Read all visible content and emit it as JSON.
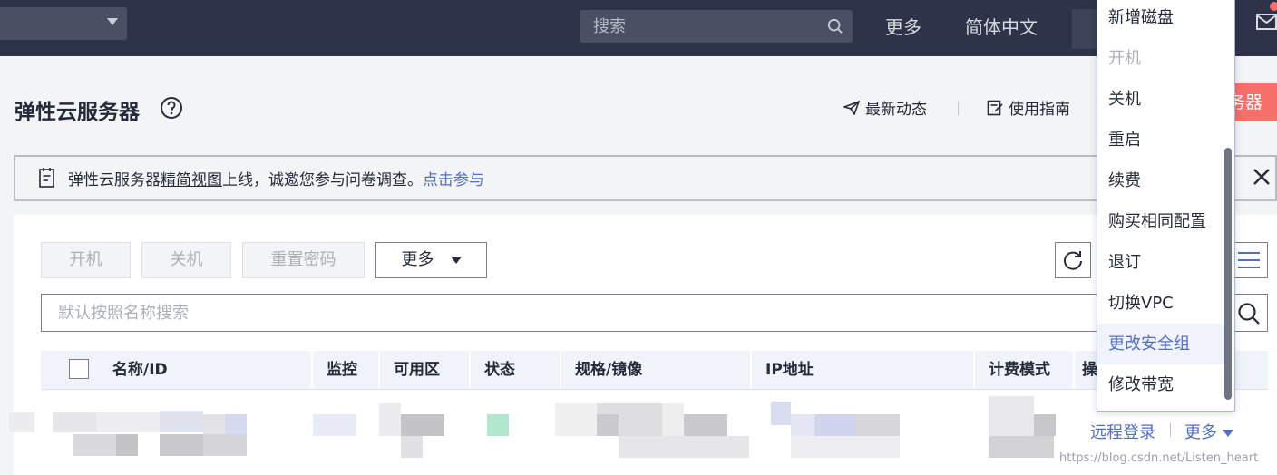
{
  "topbar": {
    "search_placeholder": "搜索",
    "more_label": "更多",
    "language_label": "简体中文"
  },
  "header": {
    "title": "弹性云服务器",
    "latest_news": "最新动态",
    "user_guide": "使用指南",
    "buy_button_partial": "务器"
  },
  "notice": {
    "text_prefix": "弹性云服务器",
    "text_underlined": "精简视图",
    "text_suffix": "上线，诚邀您参与问卷调查。",
    "link": "点击参与"
  },
  "toolbar": {
    "start_label": "开机",
    "stop_label": "关机",
    "reset_password_label": "重置密码",
    "more_label": "更多"
  },
  "search": {
    "placeholder": "默认按照名称搜索"
  },
  "table": {
    "columns": [
      "名称/ID",
      "监控",
      "可用区",
      "状态",
      "规格/镜像",
      "IP地址",
      "计费模式",
      "操"
    ],
    "row": {
      "remote_login": "远程登录",
      "more_label": "更多"
    }
  },
  "dropdown": {
    "items": [
      {
        "label": "新增磁盘",
        "state": "enabled"
      },
      {
        "label": "开机",
        "state": "disabled"
      },
      {
        "label": "关机",
        "state": "enabled"
      },
      {
        "label": "重启",
        "state": "enabled"
      },
      {
        "label": "续费",
        "state": "enabled"
      },
      {
        "label": "购买相同配置",
        "state": "enabled"
      },
      {
        "label": "退订",
        "state": "enabled"
      },
      {
        "label": "切换VPC",
        "state": "enabled"
      },
      {
        "label": "更改安全组",
        "state": "hover"
      },
      {
        "label": "修改带宽",
        "state": "enabled"
      }
    ]
  },
  "watermark": "https://blog.csdn.net/Listen_heart",
  "colors": {
    "topbar_bg": "#2e3349",
    "accent_link": "#526ecc",
    "buy_button": "#f66f6a",
    "table_header_bg": "#f0f3fa"
  }
}
